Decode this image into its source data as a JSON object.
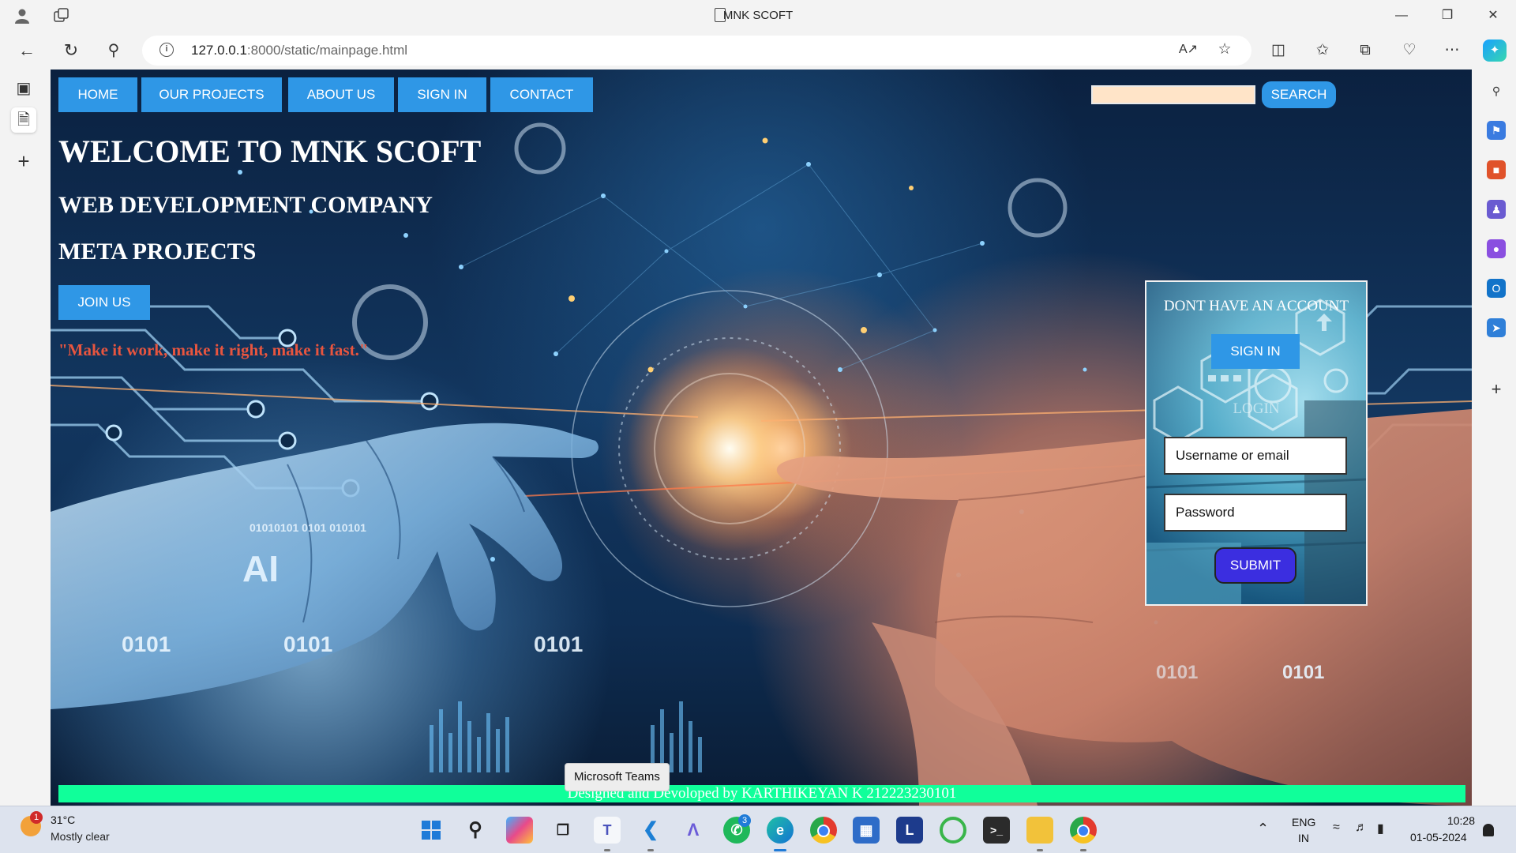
{
  "browser": {
    "tab_title": "MNK SCOFT",
    "url_host": "127.0.0.1",
    "url_rest": ":8000/static/mainpage.html",
    "window_controls": [
      "minimize-icon",
      "restore-icon",
      "close-icon"
    ]
  },
  "nav": {
    "items": [
      "HOME",
      "OUR PROJECTS",
      "ABOUT US",
      "SIGN IN",
      "CONTACT"
    ],
    "search_value": "",
    "search_button": "SEARCH"
  },
  "hero": {
    "heading": "WELCOME TO MNK SCOFT",
    "subheading": "WEB DEVELOPMENT COMPANY",
    "subheading2": "META PROJECTS",
    "join_button": "JOIN US",
    "tagline": "\"Make it work, make it right, make it fast.\""
  },
  "login_card": {
    "heading": "DONT HAVE AN ACCOUNT",
    "signin_button": "SIGN IN",
    "login_label": "LOGIN",
    "username_placeholder": "Username or email",
    "password_placeholder": "Password",
    "submit_button": "SUBMIT"
  },
  "background_text": {
    "ai": "AI",
    "binary1": "0101",
    "binary2": "0101",
    "binary3": "0101",
    "binary4": "0101",
    "binary5": "01010101 0101 010101",
    "binary6": "0101"
  },
  "footer": {
    "credit": "Designed and Devoloped by KARTHIKEYAN K 212223230101"
  },
  "tooltip": "Microsoft Teams",
  "taskbar": {
    "weather_temp": "31°C",
    "weather_desc": "Mostly clear",
    "weather_badge": "1",
    "whatsapp_badge": "3",
    "language_1": "ENG",
    "language_2": "IN",
    "time": "10:28",
    "date": "01-05-2024"
  },
  "colors": {
    "nav_blue": "#2f97e6",
    "footer_green": "#10ff9a",
    "tagline_red": "#e8553f",
    "submit_purple": "#3b2ee0",
    "search_fill": "#ffe4c8"
  }
}
